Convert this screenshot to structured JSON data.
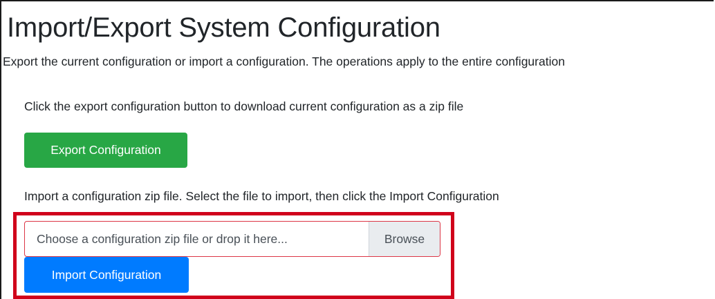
{
  "page": {
    "title": "Import/Export System Configuration",
    "description": "Export the current configuration or import a configuration. The operations apply to the entire configuration"
  },
  "export": {
    "help_text": "Click the export configuration button to download current configuration as a zip file",
    "button_label": "Export Configuration",
    "button_color": "#28a745"
  },
  "import": {
    "help_text": "Import a configuration zip file. Select the file to import, then click the Import Configuration",
    "file_input_placeholder": "Choose a configuration zip file or drop it here...",
    "browse_label": "Browse",
    "button_label": "Import Configuration",
    "button_color": "#007bff"
  },
  "highlight": {
    "color": "#d0021b"
  }
}
